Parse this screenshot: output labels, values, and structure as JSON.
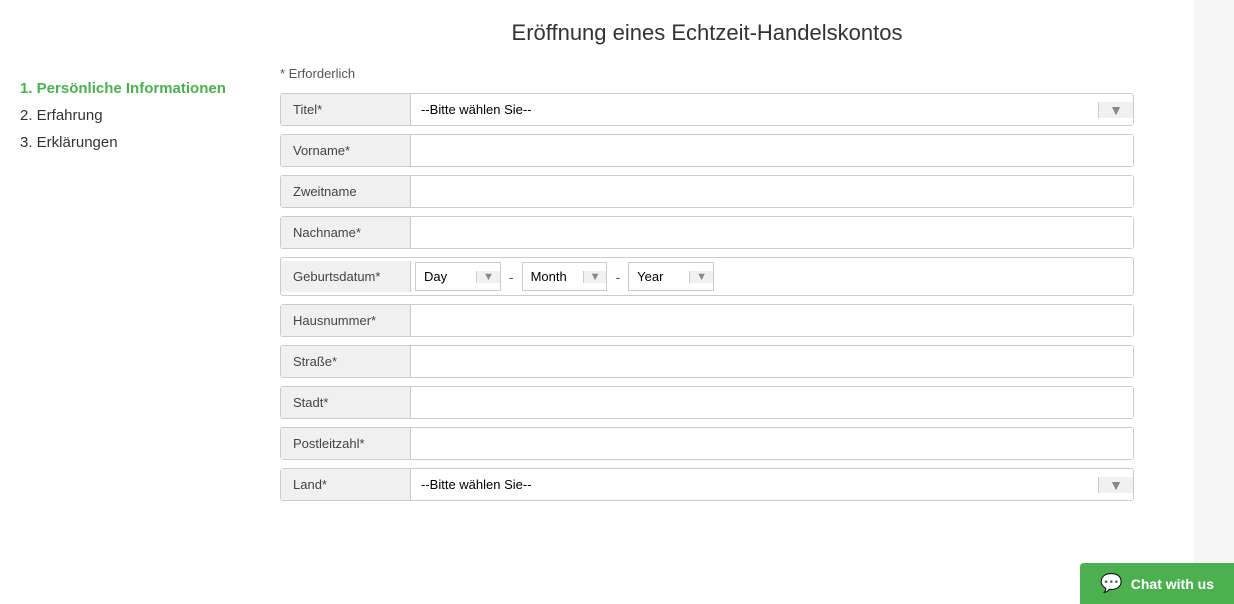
{
  "page": {
    "title": "Eröffnung eines Echtzeit-Handelskontos"
  },
  "sidebar": {
    "items": [
      {
        "label": "1. Persönliche Informationen",
        "active": true
      },
      {
        "label": "2. Erfahrung",
        "active": false
      },
      {
        "label": "3. Erklärungen",
        "active": false
      }
    ]
  },
  "form": {
    "required_note": "* Erforderlich",
    "fields": [
      {
        "label": "Titel*",
        "type": "select",
        "placeholder": "--Bitte wählen Sie--"
      },
      {
        "label": "Vorname*",
        "type": "text",
        "placeholder": ""
      },
      {
        "label": "Zweitname",
        "type": "text",
        "placeholder": ""
      },
      {
        "label": "Nachname*",
        "type": "text",
        "placeholder": ""
      },
      {
        "label": "Hausnummer*",
        "type": "text",
        "placeholder": ""
      },
      {
        "label": "Straße*",
        "type": "text",
        "placeholder": ""
      },
      {
        "label": "Stadt*",
        "type": "text",
        "placeholder": ""
      },
      {
        "label": "Postleitzahl*",
        "type": "text",
        "placeholder": ""
      },
      {
        "label": "Land*",
        "type": "select",
        "placeholder": "--Bitte wählen Sie--"
      }
    ],
    "dob": {
      "label": "Geburtsdatum*",
      "day_placeholder": "Day",
      "month_placeholder": "Month",
      "year_placeholder": "Year"
    }
  },
  "chat": {
    "label": "Chat with us"
  }
}
